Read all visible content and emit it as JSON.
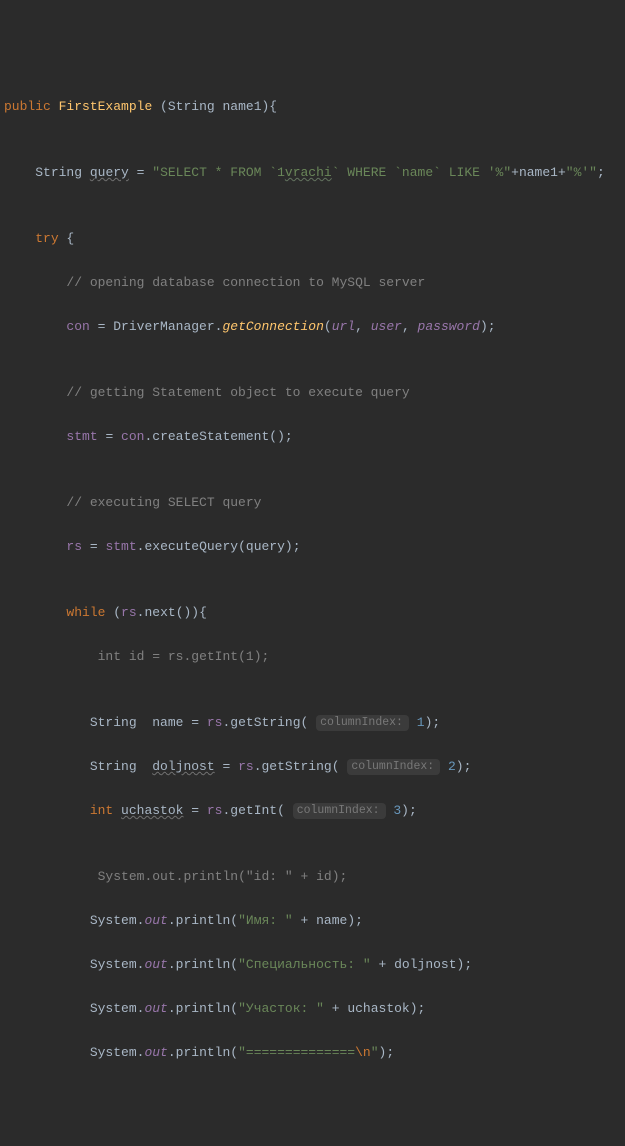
{
  "kw": {
    "public": "public",
    "try": "try",
    "while": "while",
    "int": "int"
  },
  "types": {
    "String": "String"
  },
  "method_name": "FirstExample",
  "param_name": "name1",
  "vars": {
    "query": "query",
    "con": "con",
    "stmt": "stmt",
    "rs": "rs",
    "id": "id",
    "name": "name",
    "doljnost": "doljnost",
    "uchastok": "uchastok",
    "url": "url",
    "user": "user",
    "password": "password"
  },
  "calls": {
    "DriverManager": "DriverManager",
    "getConnection": "getConnection",
    "createStatement": "createStatement",
    "executeQuery": "executeQuery",
    "next": "next",
    "getInt": "getInt",
    "getString": "getString",
    "System": "System",
    "out": "out",
    "println": "println"
  },
  "strings": {
    "select_a": "\"SELECT * FROM `1",
    "select_wavy": "vrachi",
    "select_b": "` WHERE `name` LIKE '%\"",
    "select_c": "\"%'\"",
    "id_prefix": "\"id: \"",
    "name_prefix": "\"Имя: \"",
    "spec_prefix": "\"Специальность: \"",
    "uch_prefix": "\"Участок: \"",
    "sep": "\"==============",
    "sep_nl": "\\n",
    "sep_end": "\""
  },
  "comments": {
    "open_db": "// opening database connection to MySQL server",
    "getting_stmt": "// getting Statement object to execute query",
    "exec_sel": "// executing SELECT query"
  },
  "hints": {
    "col1": "columnIndex:",
    "col2": "columnIndex:",
    "col3": "columnIndex:"
  },
  "nums": {
    "n1_getint": "1",
    "h1": "1",
    "h2": "2",
    "h3": "3"
  }
}
